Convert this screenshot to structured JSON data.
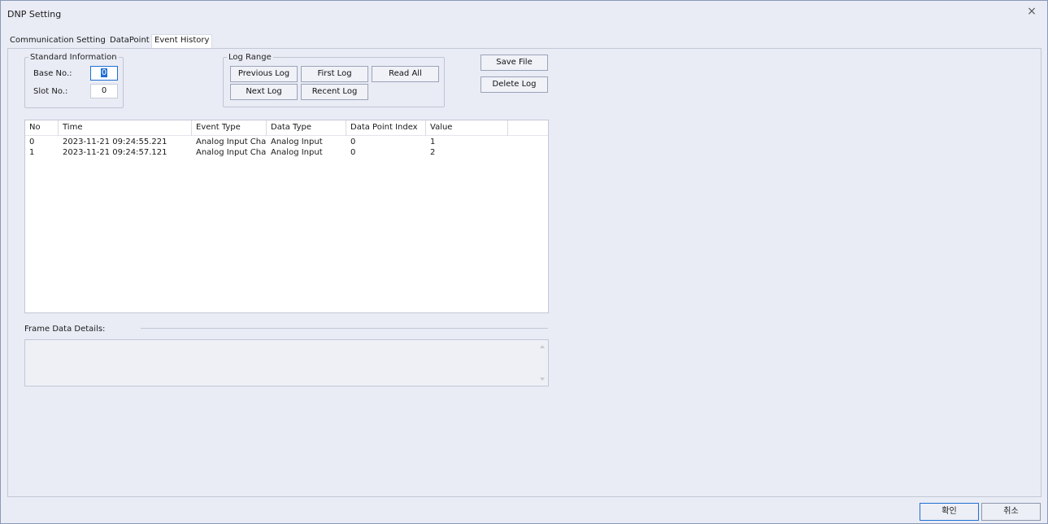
{
  "window": {
    "title": "DNP Setting",
    "close_glyph": "×"
  },
  "tabs": [
    {
      "label": "Communication Setting"
    },
    {
      "label": "DataPoint"
    },
    {
      "label": "Event History",
      "active": true
    }
  ],
  "standard_info": {
    "legend": "Standard Information",
    "base_label": "Base No.:",
    "base_value": "0",
    "slot_label": "Slot No.:",
    "slot_value": "0"
  },
  "log_range": {
    "legend": "Log Range",
    "previous_log": "Previous Log",
    "first_log": "First Log",
    "read_all": "Read All",
    "next_log": "Next Log",
    "recent_log": "Recent Log"
  },
  "actions": {
    "save_file": "Save File",
    "delete_log": "Delete Log"
  },
  "event_table": {
    "columns": [
      "No",
      "Time",
      "Event Type",
      "Data Type",
      "Data Point Index",
      "Value"
    ],
    "rows": [
      [
        "0",
        "2023-11-21 09:24:55.221",
        "Analog Input Cha...",
        "Analog Input",
        "0",
        "1"
      ],
      [
        "1",
        "2023-11-21 09:24:57.121",
        "Analog Input Cha...",
        "Analog Input",
        "0",
        "2"
      ]
    ]
  },
  "frame_details": {
    "label": "Frame Data Details:",
    "content": ""
  },
  "footer": {
    "ok": "확인",
    "cancel": "취소"
  },
  "colors": {
    "accent": "#1f6ed4",
    "background": "#e9ecf5"
  }
}
